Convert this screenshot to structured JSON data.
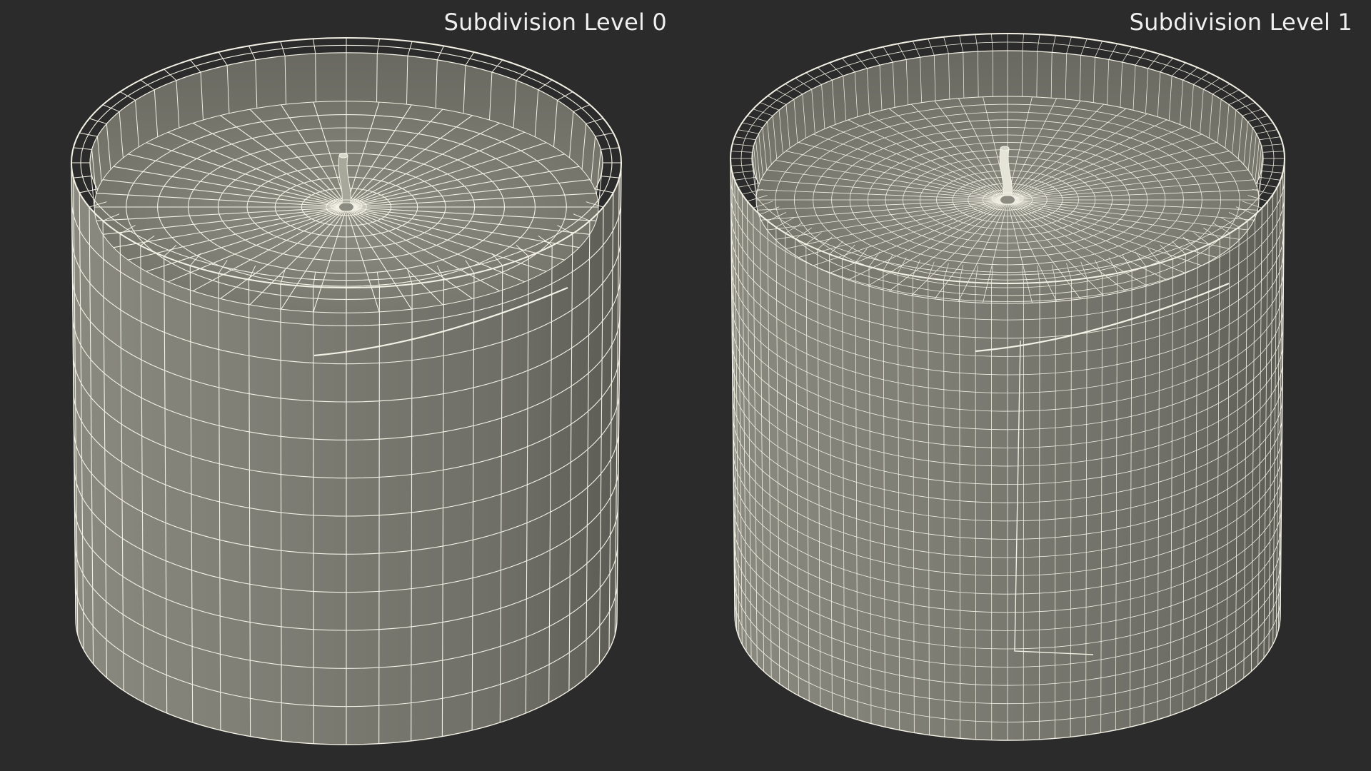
{
  "panels": [
    {
      "title": "Subdivision Level 0",
      "subdivision_level": 0
    },
    {
      "title": "Subdivision Level 1",
      "subdivision_level": 1
    }
  ],
  "colors": {
    "background": "#2b2b2b",
    "surface": "#7c7b72",
    "surface_dark": "#5e5e57",
    "surface_light": "#9a9990",
    "wire": "#f4f2e6",
    "title_text": "#f0f0f0"
  },
  "objects": [
    {
      "name": "candle-jar-level-0",
      "wireframe": true,
      "shading": "gray"
    },
    {
      "name": "candle-jar-level-1",
      "wireframe": true,
      "shading": "gray"
    }
  ]
}
